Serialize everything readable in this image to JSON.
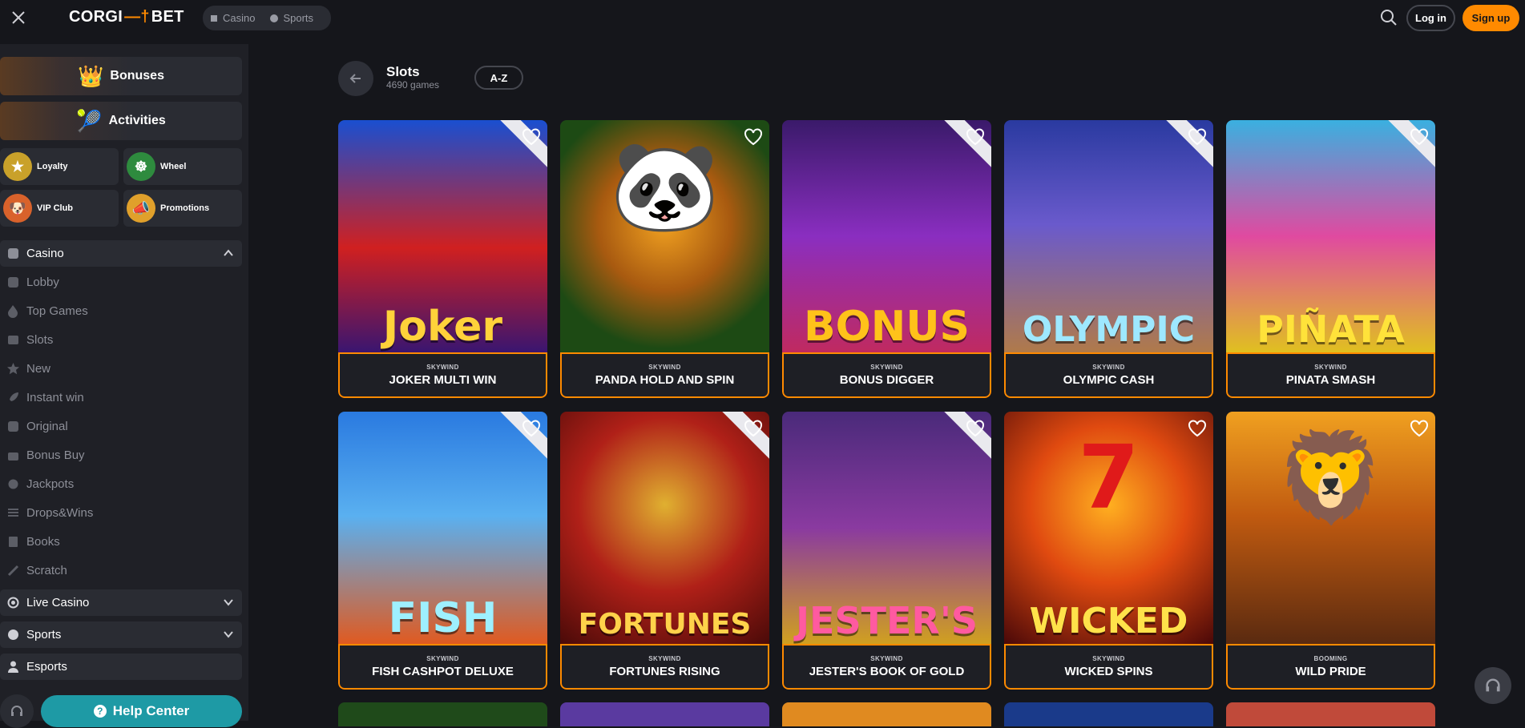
{
  "header": {
    "logo_left": "CORGI",
    "logo_right": "BET",
    "tabs": [
      {
        "label": "Casino"
      },
      {
        "label": "Sports"
      }
    ],
    "login_label": "Log in",
    "signup_label": "Sign up"
  },
  "sidebar": {
    "bonuses_label": "Bonuses",
    "activities_label": "Activities",
    "tiles": [
      {
        "label": "Loyalty"
      },
      {
        "label": "Wheel"
      },
      {
        "label": "VIP Club"
      },
      {
        "label": "Promotions"
      }
    ],
    "casino_label": "Casino",
    "nav": [
      {
        "label": "Lobby"
      },
      {
        "label": "Top Games"
      },
      {
        "label": "Slots"
      },
      {
        "label": "New"
      },
      {
        "label": "Instant win"
      },
      {
        "label": "Original"
      },
      {
        "label": "Bonus Buy"
      },
      {
        "label": "Jackpots"
      },
      {
        "label": "Drops&Wins"
      },
      {
        "label": "Books"
      },
      {
        "label": "Scratch"
      }
    ],
    "live_casino_label": "Live Casino",
    "sports_label": "Sports",
    "esports_label": "Esports",
    "help_label": "Help Center"
  },
  "main": {
    "title": "Slots",
    "count": "4690 games",
    "sort_label": "A-Z",
    "games": [
      {
        "provider": "SKYWIND",
        "name": "JOKER MULTI WIN",
        "art": "Joker"
      },
      {
        "provider": "SKYWIND",
        "name": "PANDA HOLD AND SPIN",
        "art": ""
      },
      {
        "provider": "SKYWIND",
        "name": "BONUS DIGGER",
        "art": "BONUS"
      },
      {
        "provider": "SKYWIND",
        "name": "OLYMPIC CASH",
        "art": "OLYMPIC"
      },
      {
        "provider": "SKYWIND",
        "name": "PINATA SMASH",
        "art": "PIÑATA"
      },
      {
        "provider": "SKYWIND",
        "name": "FISH CASHPOT DELUXE",
        "art": "FISH"
      },
      {
        "provider": "SKYWIND",
        "name": "FORTUNES RISING",
        "art": "FORTUNES"
      },
      {
        "provider": "SKYWIND",
        "name": "JESTER'S BOOK OF GOLD",
        "art": "JESTER'S"
      },
      {
        "provider": "SKYWIND",
        "name": "WICKED SPINS",
        "art": "WICKED"
      },
      {
        "provider": "BOOMING",
        "name": "WILD PRIDE",
        "art": ""
      }
    ]
  },
  "colors": {
    "accent": "#ff8a00",
    "help": "#1e9aa5",
    "panel": "#2a2c33",
    "background": "#15161b"
  }
}
